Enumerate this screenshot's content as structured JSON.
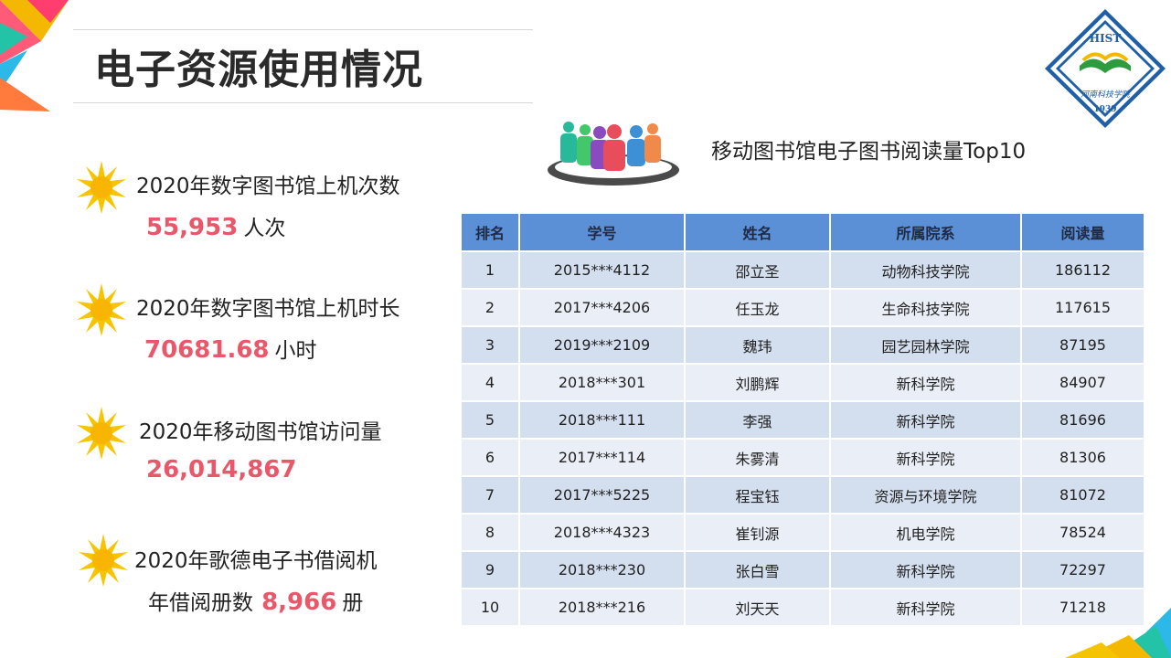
{
  "title": "电子资源使用情况",
  "logo": {
    "top_text": "HIST",
    "script_text": "河南科技学院",
    "year": "1939"
  },
  "stats": [
    {
      "label": "2020年数字图书馆上机次数",
      "value": "55,953",
      "unit": "人次"
    },
    {
      "label": "2020年数字图书馆上机时长",
      "value": "70681.68",
      "unit": "小时"
    },
    {
      "label": "2020年移动图书馆访问量",
      "value": "26,014,867",
      "unit": ""
    },
    {
      "label": "2020年歌德电子书借阅机",
      "label2_prefix": "年借阅册数",
      "value": "8,966",
      "unit": "册"
    }
  ],
  "table_title": "移动图书馆电子图书阅读量Top10",
  "table": {
    "headers": [
      "排名",
      "学号",
      "姓名",
      "所属院系",
      "阅读量"
    ],
    "rows": [
      [
        "1",
        "2015***4112",
        "邵立圣",
        "动物科技学院",
        "186112"
      ],
      [
        "2",
        "2017***4206",
        "任玉龙",
        "生命科技学院",
        "117615"
      ],
      [
        "3",
        "2019***2109",
        "魏玮",
        "园艺园林学院",
        "87195"
      ],
      [
        "4",
        "2018***301",
        "刘鹏辉",
        "新科学院",
        "84907"
      ],
      [
        "5",
        "2018***111",
        "李强",
        "新科学院",
        "81696"
      ],
      [
        "6",
        "2017***114",
        "朱雾清",
        "新科学院",
        "81306"
      ],
      [
        "7",
        "2017***5225",
        "程宝钰",
        "资源与环境学院",
        "81072"
      ],
      [
        "8",
        "2018***4323",
        "崔钊源",
        "机电学院",
        "78524"
      ],
      [
        "9",
        "2018***230",
        "张白雪",
        "新科学院",
        "72297"
      ],
      [
        "10",
        "2018***216",
        "刘天天",
        "新科学院",
        "71218"
      ]
    ]
  },
  "colors": {
    "accent": "#e9576a",
    "header": "#5b8fd6",
    "row_a": "#d3deef",
    "row_b": "#e9eef7"
  }
}
